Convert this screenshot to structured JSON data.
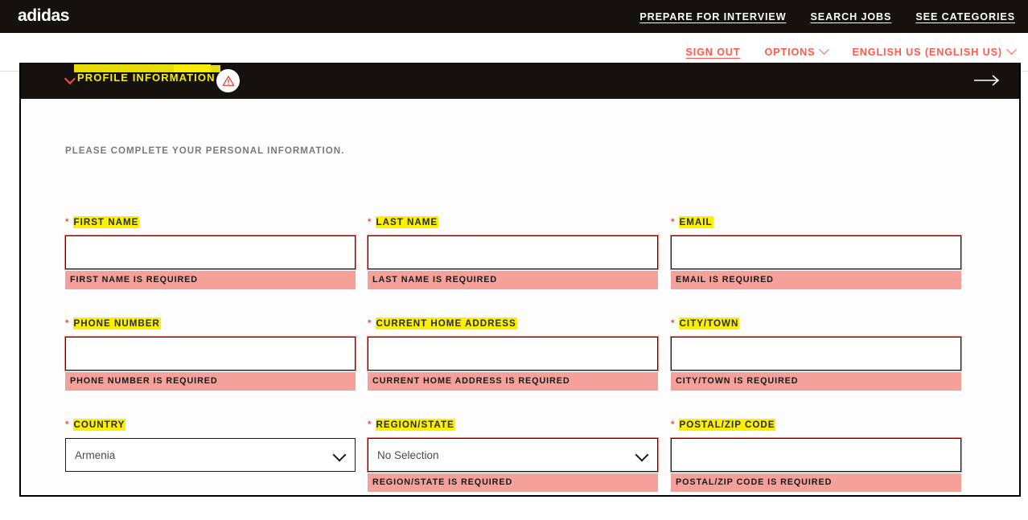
{
  "brand": {
    "name": "adidas"
  },
  "topnav": {
    "links": [
      {
        "label": "PREPARE FOR INTERVIEW"
      },
      {
        "label": "SEARCH JOBS"
      },
      {
        "label": "SEE CATEGORIES"
      }
    ]
  },
  "subnav": {
    "sign_out": "SIGN OUT",
    "options": "OPTIONS",
    "language": "ENGLISH US (ENGLISH US)",
    "accent_color": "#FF594A"
  },
  "section": {
    "title": "PROFILE INFORMATION",
    "title_color": "#F6F000",
    "has_warning": true,
    "next_arrow": "→"
  },
  "form": {
    "intro": "PLEASE COMPLETE YOUR PERSONAL INFORMATION.",
    "required_marker": "*",
    "rows": [
      [
        {
          "label": "FIRST NAME",
          "type": "text",
          "value": "",
          "error": "FIRST NAME IS REQUIRED",
          "invalid": true
        },
        {
          "label": "LAST NAME",
          "type": "text",
          "value": "",
          "error": "LAST NAME IS REQUIRED",
          "invalid": true
        },
        {
          "label": "EMAIL",
          "type": "text",
          "value": "",
          "error": "EMAIL IS REQUIRED",
          "invalid": true
        }
      ],
      [
        {
          "label": "PHONE NUMBER",
          "type": "text",
          "value": "",
          "error": "PHONE NUMBER IS REQUIRED",
          "invalid": true
        },
        {
          "label": "CURRENT HOME ADDRESS",
          "type": "text",
          "value": "",
          "error": "CURRENT HOME ADDRESS IS REQUIRED",
          "invalid": true
        },
        {
          "label": "CITY/TOWN",
          "type": "text",
          "value": "",
          "error": "CITY/TOWN IS REQUIRED",
          "invalid": true
        }
      ],
      [
        {
          "label": "COUNTRY",
          "type": "select",
          "value": "Armenia",
          "error": "",
          "invalid": false
        },
        {
          "label": "REGION/STATE",
          "type": "select",
          "value": "No Selection",
          "error": "REGION/STATE IS REQUIRED",
          "invalid": true
        },
        {
          "label": "POSTAL/ZIP CODE",
          "type": "text",
          "value": "",
          "error": "POSTAL/ZIP CODE IS REQUIRED",
          "invalid": true
        }
      ]
    ]
  },
  "colors": {
    "error_bg": "#F5A199",
    "error_border": "#F2897E",
    "highlight": "#FAF000",
    "black": "#15110F"
  }
}
